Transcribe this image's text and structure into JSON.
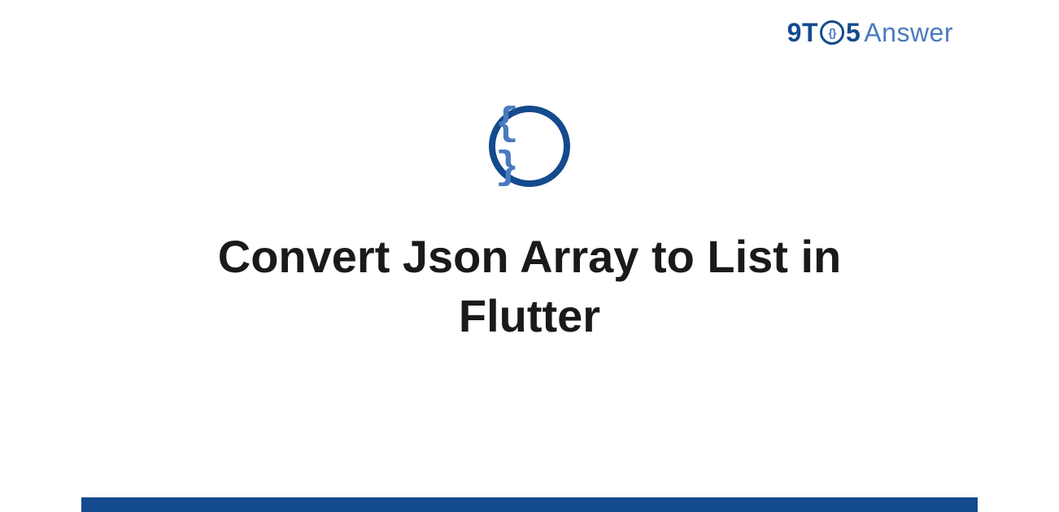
{
  "logo": {
    "prefix_9t": "9T",
    "circle_content": "{}",
    "five": "5",
    "answer": "Answer"
  },
  "icon": {
    "braces": "{ }"
  },
  "title": "Convert Json Array to List in Flutter",
  "colors": {
    "dark_blue": "#144a8e",
    "light_blue": "#4a7abf",
    "text": "#1a1a1a"
  }
}
